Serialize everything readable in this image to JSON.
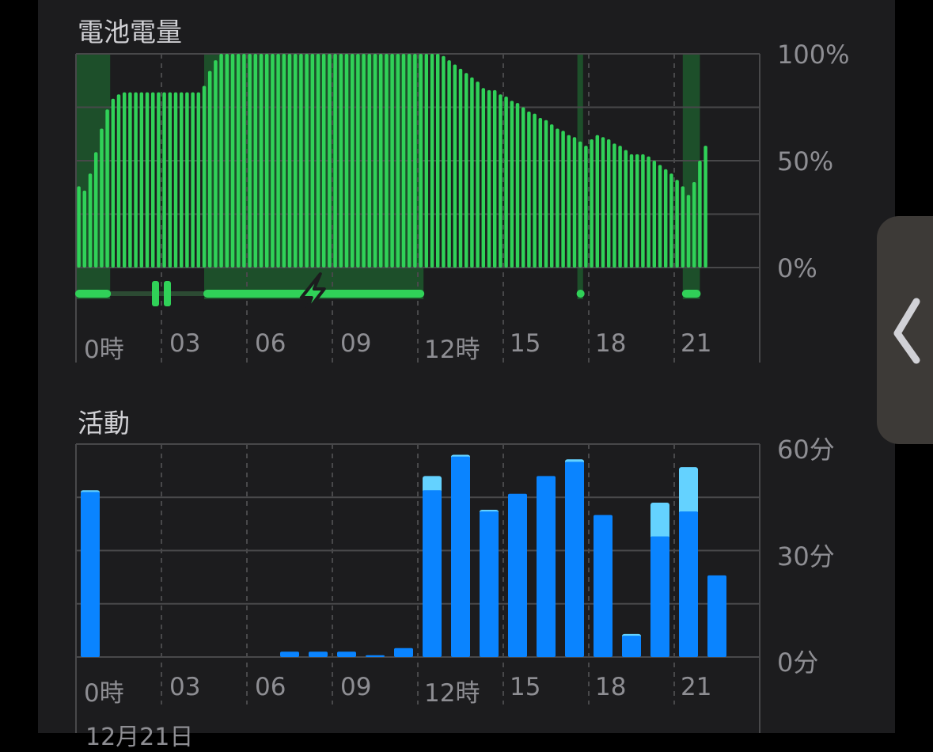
{
  "battery": {
    "title": "電池電量",
    "y_ticks": [
      "100%",
      "50%",
      "0%"
    ]
  },
  "activity": {
    "title": "活動",
    "y_ticks": [
      "60分",
      "30分",
      "0分"
    ]
  },
  "x_ticks": [
    "0時",
    "03",
    "06",
    "09",
    "12時",
    "15",
    "18",
    "21"
  ],
  "date_label": "12月21日",
  "colors": {
    "battery_bar": "#30d158",
    "charging_band": "#1d4f2a",
    "activity_main": "#0a84ff",
    "activity_light": "#64d2ff",
    "grid": "#48484a",
    "background": "#1c1c1e"
  },
  "icons": [
    "pause-icon",
    "charging-bolt-icon",
    "chevron-left-icon"
  ],
  "chart_data": [
    {
      "type": "bar",
      "title": "電池電量",
      "x_unit": "hour",
      "xlim": [
        0,
        24
      ],
      "ylim": [
        0,
        100
      ],
      "grid": true,
      "x": [
        0.1,
        0.3,
        0.5,
        0.7,
        0.9,
        1.1,
        1.3,
        1.5,
        1.7,
        1.9,
        2.1,
        2.3,
        2.5,
        2.7,
        2.9,
        3.1,
        3.3,
        3.5,
        3.7,
        3.9,
        4.1,
        4.3,
        4.5,
        4.7,
        4.9,
        5.1,
        5.3,
        5.5,
        5.7,
        5.9,
        6.1,
        6.3,
        6.5,
        6.7,
        6.9,
        7.1,
        7.3,
        7.5,
        7.7,
        7.9,
        8.1,
        8.3,
        8.5,
        8.7,
        8.9,
        9.1,
        9.3,
        9.5,
        9.7,
        9.9,
        10.1,
        10.3,
        10.5,
        10.7,
        10.9,
        11.1,
        11.3,
        11.5,
        11.7,
        11.9,
        12.1,
        12.3,
        12.5,
        12.7,
        12.9,
        13.1,
        13.3,
        13.5,
        13.7,
        13.9,
        14.1,
        14.3,
        14.5,
        14.7,
        14.9,
        15.1,
        15.3,
        15.5,
        15.7,
        15.9,
        16.1,
        16.3,
        16.5,
        16.7,
        16.9,
        17.1,
        17.3,
        17.5,
        17.7,
        17.9,
        18.1,
        18.3,
        18.5,
        18.7,
        18.9,
        19.1,
        19.3,
        19.5,
        19.7,
        19.9,
        20.1,
        20.3,
        20.5,
        20.7,
        20.9,
        21.1,
        21.3,
        21.5,
        21.7,
        21.9,
        22.1,
        22.3
      ],
      "values": [
        38,
        36,
        44,
        54,
        65,
        74,
        79,
        81,
        82,
        82,
        82,
        82,
        82,
        82,
        82,
        82,
        82,
        82,
        82,
        82,
        82,
        82,
        85,
        92,
        97,
        100,
        100,
        100,
        100,
        100,
        100,
        100,
        100,
        100,
        100,
        100,
        100,
        100,
        100,
        100,
        100,
        100,
        100,
        100,
        100,
        100,
        100,
        100,
        100,
        100,
        100,
        100,
        100,
        100,
        100,
        100,
        100,
        100,
        100,
        100,
        100,
        100,
        100,
        100,
        99,
        97,
        95,
        93,
        91,
        89,
        87,
        84,
        83,
        83,
        81,
        80,
        78,
        77,
        75,
        73,
        72,
        70,
        69,
        67,
        65,
        64,
        62,
        61,
        59,
        57,
        60,
        62,
        61,
        60,
        58,
        57,
        55,
        53,
        53,
        53,
        52,
        50,
        48,
        46,
        44,
        41,
        38,
        34,
        40,
        50,
        57
      ],
      "charging_hours": [
        [
          0,
          1.2
        ],
        [
          4.5,
          12.2
        ],
        [
          17.6,
          17.8
        ],
        [
          21.3,
          21.9
        ]
      ],
      "pause_hour": 3.0,
      "bolt_hour": 8.3
    },
    {
      "type": "bar",
      "title": "活動",
      "x_unit": "hour",
      "xlim": [
        0,
        24
      ],
      "ylim": [
        0,
        60
      ],
      "grid": true,
      "x": [
        0.5,
        7.5,
        8.5,
        9.5,
        10.5,
        11.5,
        12.5,
        13.5,
        14.5,
        15.5,
        16.5,
        17.5,
        18.5,
        19.5,
        20.5,
        21.5,
        22.5
      ],
      "series": [
        {
          "name": "",
          "values": [
            46.5,
            1.5,
            1.5,
            1.5,
            0.5,
            2.5,
            47,
            56.5,
            41,
            46,
            51,
            55,
            40,
            6,
            34,
            41,
            23
          ]
        },
        {
          "name": "",
          "values": [
            0.5,
            0,
            0,
            0,
            0,
            0,
            4,
            0.5,
            0.5,
            0,
            0,
            0.7,
            0,
            0.5,
            9.5,
            12.5,
            0
          ]
        }
      ]
    }
  ]
}
